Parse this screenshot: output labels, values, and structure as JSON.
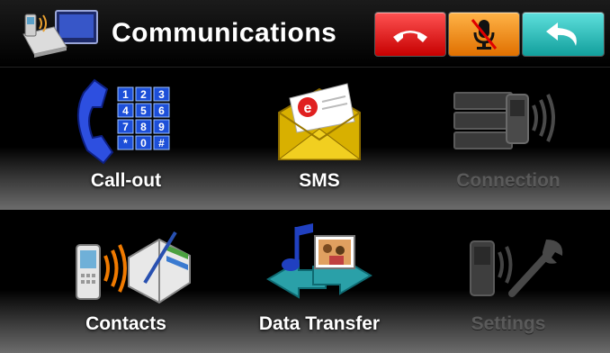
{
  "header": {
    "title": "Communications",
    "app_icon": "phone-book-signal-icon",
    "buttons": [
      {
        "name": "hang-up",
        "icon": "hang-up-icon",
        "color": "#e01010"
      },
      {
        "name": "mute",
        "icon": "mic-muted-icon",
        "color": "#f08a00"
      },
      {
        "name": "back",
        "icon": "back-arrow-icon",
        "color": "#2cc0bd"
      }
    ]
  },
  "menu": {
    "items": [
      {
        "label": "Call-out",
        "icon": "phone-keypad-icon",
        "enabled": true
      },
      {
        "label": "SMS",
        "icon": "envelope-icon",
        "enabled": true
      },
      {
        "label": "Connection",
        "icon": "connection-icon",
        "enabled": false
      },
      {
        "label": "Contacts",
        "icon": "contacts-book-icon",
        "enabled": true
      },
      {
        "label": "Data Transfer",
        "icon": "data-transfer-icon",
        "enabled": true
      },
      {
        "label": "Settings",
        "icon": "phone-wrench-icon",
        "enabled": false
      }
    ]
  }
}
